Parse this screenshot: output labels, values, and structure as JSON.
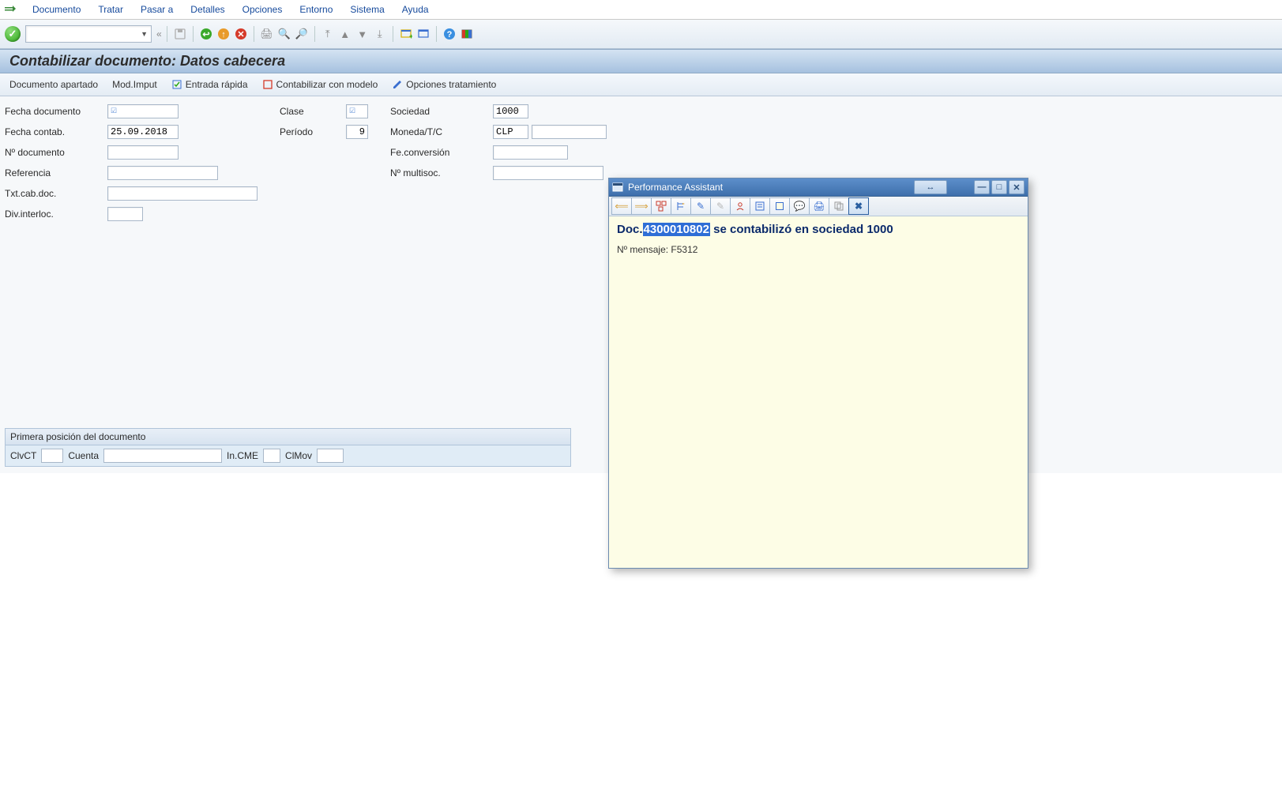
{
  "menu": {
    "items": [
      "Documento",
      "Tratar",
      "Pasar a",
      "Detalles",
      "Opciones",
      "Entorno",
      "Sistema",
      "Ayuda"
    ]
  },
  "toolbar": {
    "command_value": ""
  },
  "title": "Contabilizar documento: Datos cabecera",
  "apptoolbar": {
    "documento_apartado": "Documento apartado",
    "mod_imput": "Mod.Imput",
    "entrada_rapida": "Entrada rápida",
    "contab_modelo": "Contabilizar con modelo",
    "opciones_trat": "Opciones tratamiento"
  },
  "form": {
    "labels": {
      "fecha_doc": "Fecha documento",
      "fecha_contab": "Fecha contab.",
      "n_doc": "Nº documento",
      "referencia": "Referencia",
      "txt_cab": "Txt.cab.doc.",
      "div_interloc": "Div.interloc.",
      "clase": "Clase",
      "periodo": "Período",
      "sociedad": "Sociedad",
      "moneda": "Moneda/T/C",
      "fe_conv": "Fe.conversión",
      "n_multisoc": "Nº multisoc."
    },
    "values": {
      "fecha_doc": "",
      "fecha_contab": "25.09.2018",
      "n_doc": "",
      "referencia": "",
      "txt_cab": "",
      "div_interloc": "",
      "clase": "",
      "periodo": "9",
      "sociedad": "1000",
      "moneda": "CLP",
      "moneda_rate": "",
      "fe_conv": "",
      "n_multisoc": ""
    }
  },
  "line": {
    "title": "Primera posición del documento",
    "labels": {
      "clvct": "ClvCT",
      "cuenta": "Cuenta",
      "incme": "In.CME",
      "clmov": "ClMov"
    },
    "values": {
      "clvct": "",
      "cuenta": "",
      "incme": "",
      "clmov": ""
    }
  },
  "popup": {
    "title": "Performance Assistant",
    "message_prefix": "Doc.",
    "message_docnum": "4300010802",
    "message_suffix": " se contabilizó en sociedad 1000",
    "message_number_label": "Nº mensaje: ",
    "message_number": "F5312"
  }
}
